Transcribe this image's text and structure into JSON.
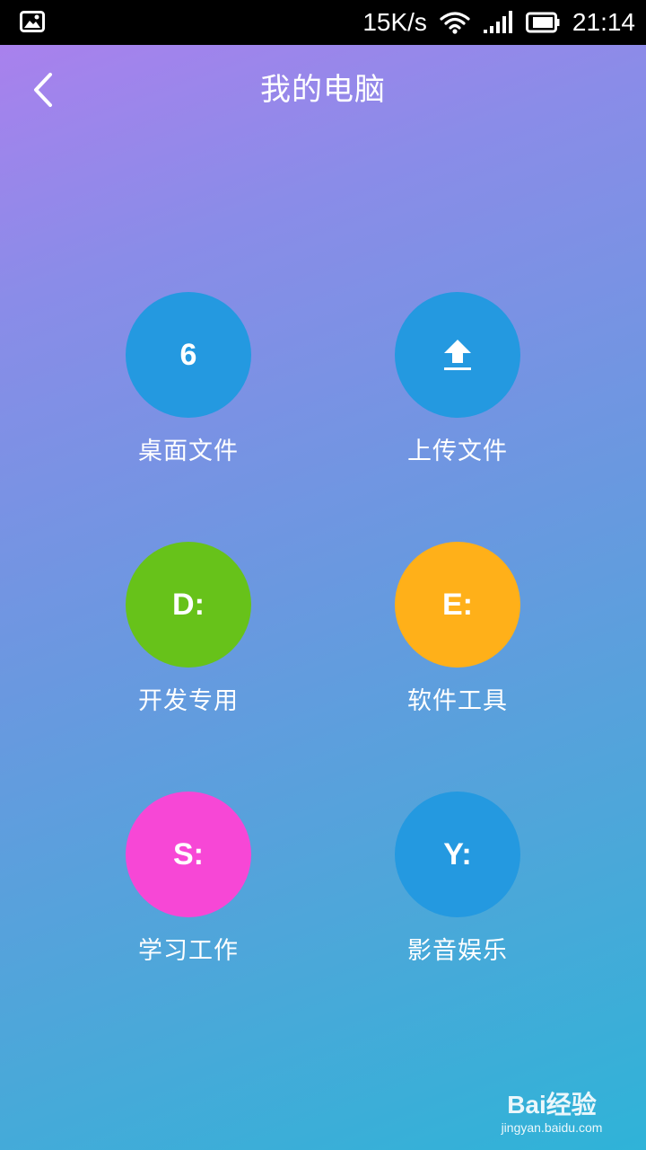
{
  "status_bar": {
    "network_speed": "15K/s",
    "time": "21:14",
    "icons": [
      "image-icon",
      "wifi-icon",
      "signal-icon",
      "battery-icon"
    ]
  },
  "header": {
    "title": "我的电脑",
    "back_icon": "chevron-left-icon"
  },
  "tiles": [
    {
      "id": "desktop-files",
      "symbol": "6",
      "label": "桌面文件",
      "color": "#2499e0"
    },
    {
      "id": "upload-files",
      "symbol": "",
      "icon": "upload-icon",
      "label": "上传文件",
      "color": "#2499e0"
    },
    {
      "id": "drive-d",
      "symbol": "D:",
      "label": "开发专用",
      "color": "#67c21a"
    },
    {
      "id": "drive-e",
      "symbol": "E:",
      "label": "软件工具",
      "color": "#ffb019"
    },
    {
      "id": "drive-s",
      "symbol": "S:",
      "label": "学习工作",
      "color": "#f747d6"
    },
    {
      "id": "drive-y",
      "symbol": "Y:",
      "label": "影音娱乐",
      "color": "#2499e0"
    }
  ],
  "watermark": {
    "logo_text": "Bai经验",
    "url": "jingyan.baidu.com"
  }
}
